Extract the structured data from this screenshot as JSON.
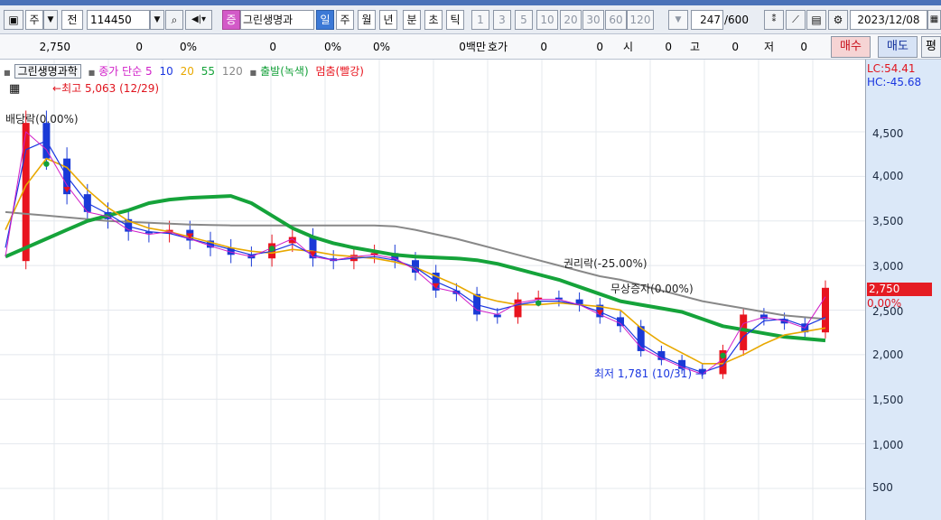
{
  "toolbar": {
    "market_label": "주",
    "prev_label": "전",
    "code_value": "114450",
    "jeung_label": "증",
    "stock_name": "그린생명과",
    "periods": [
      "일",
      "주",
      "월",
      "년",
      "분",
      "초",
      "틱"
    ],
    "intervals": [
      "1",
      "3",
      "5",
      "10",
      "20",
      "30",
      "60",
      "120"
    ],
    "count_value": "247",
    "count_total": "/600",
    "date_value": "2023/12/08"
  },
  "quote": {
    "price": "2,750",
    "change": "0",
    "rate": "0%",
    "volume": "0",
    "vol_rate": "0%",
    "turnover_rate": "0%",
    "amount": "0백만",
    "hoga_label": "호가",
    "hoga_val1": "0",
    "hoga_val2": "0",
    "open_label": "시",
    "open_val": "0",
    "high_label": "고",
    "high_val": "0",
    "low_label": "저",
    "low_val": "0",
    "buy_label": "매수",
    "sell_label": "매도",
    "eval_label": "평"
  },
  "legend": {
    "name": "그린생명과학",
    "ma_title": "종가 단순",
    "ma5": "5",
    "ma10": "10",
    "ma20": "20",
    "ma55": "55",
    "ma120": "120",
    "start_label": "출발(녹색)",
    "stop_label": "멈춤(빨강)"
  },
  "colors": {
    "ma5": "#d01ec8",
    "ma10": "#1a36e0",
    "ma20": "#e8a800",
    "ma55": "#15a33a",
    "ma120": "#888888",
    "up": "#e8141e",
    "down": "#1a3ad6",
    "start": "#14a03a",
    "stop": "#e8141e"
  },
  "annotations": {
    "high": "최고 5,063 (12/29)",
    "dividend": "배당락(0.00%)",
    "rights": "권리락(-25.00%)",
    "free_issue": "무상증자(0.00%)",
    "low": "최저 1,781 (10/31)"
  },
  "axis": {
    "lc": "LC:54.41",
    "hc": "HC:-45.68",
    "ticks": [
      "4,500",
      "4,000",
      "3,500",
      "3,000",
      "2,500",
      "2,000",
      "1,500",
      "1,000",
      "500"
    ],
    "current": "2,750",
    "current_rate": "0.00%"
  },
  "chart_data": {
    "type": "line",
    "title": "",
    "ylim": [
      300,
      5200
    ],
    "series": [
      {
        "name": "120",
        "values": [
          3600,
          3580,
          3560,
          3540,
          3520,
          3500,
          3490,
          3480,
          3470,
          3460,
          3455,
          3450,
          3450,
          3450,
          3450,
          3450,
          3450,
          3450,
          3450,
          3440,
          3400,
          3350,
          3300,
          3240,
          3180,
          3120,
          3060,
          3000,
          2940,
          2880,
          2840,
          2780,
          2720,
          2660,
          2600,
          2560,
          2520,
          2480,
          2440,
          2420,
          2400
        ]
      },
      {
        "name": "55",
        "values": [
          3100,
          3200,
          3300,
          3400,
          3500,
          3560,
          3620,
          3700,
          3740,
          3760,
          3770,
          3780,
          3700,
          3560,
          3420,
          3320,
          3250,
          3200,
          3160,
          3120,
          3100,
          3090,
          3080,
          3060,
          3020,
          2960,
          2900,
          2840,
          2760,
          2680,
          2600,
          2560,
          2520,
          2480,
          2400,
          2320,
          2280,
          2240,
          2200,
          2180,
          2160
        ]
      },
      {
        "name": "20",
        "values": [
          3400,
          3900,
          4200,
          4100,
          3850,
          3650,
          3500,
          3420,
          3380,
          3320,
          3260,
          3200,
          3160,
          3140,
          3180,
          3160,
          3120,
          3100,
          3080,
          3040,
          2980,
          2880,
          2780,
          2660,
          2600,
          2560,
          2560,
          2580,
          2560,
          2540,
          2500,
          2300,
          2140,
          2020,
          1900,
          1900,
          2000,
          2120,
          2220,
          2260,
          2300
        ]
      },
      {
        "name": "10",
        "values": [
          3200,
          4300,
          4400,
          4000,
          3700,
          3580,
          3440,
          3380,
          3360,
          3300,
          3240,
          3180,
          3120,
          3160,
          3240,
          3120,
          3060,
          3080,
          3100,
          3060,
          2980,
          2820,
          2720,
          2560,
          2500,
          2560,
          2600,
          2600,
          2560,
          2480,
          2380,
          2120,
          1980,
          1880,
          1800,
          1880,
          2200,
          2380,
          2400,
          2320,
          2420
        ]
      },
      {
        "name": "5",
        "values": [
          3100,
          4500,
          4300,
          3900,
          3600,
          3550,
          3400,
          3350,
          3380,
          3300,
          3220,
          3150,
          3100,
          3200,
          3300,
          3100,
          3060,
          3100,
          3120,
          3080,
          2950,
          2750,
          2700,
          2500,
          2450,
          2580,
          2620,
          2620,
          2560,
          2450,
          2350,
          2080,
          1960,
          1860,
          1781,
          1950,
          2350,
          2420,
          2380,
          2300,
          2650
        ]
      },
      {
        "name": "close",
        "values": [
          3050,
          4600,
          4200,
          3800,
          3600,
          3520,
          3380,
          3360,
          3400,
          3280,
          3200,
          3120,
          3080,
          3250,
          3320,
          3080,
          3050,
          3120,
          3140,
          3060,
          2920,
          2720,
          2680,
          2450,
          2420,
          2620,
          2640,
          2620,
          2560,
          2420,
          2320,
          2040,
          1940,
          1840,
          1781,
          2050,
          2450,
          2400,
          2350,
          2250,
          2750
        ]
      }
    ]
  }
}
